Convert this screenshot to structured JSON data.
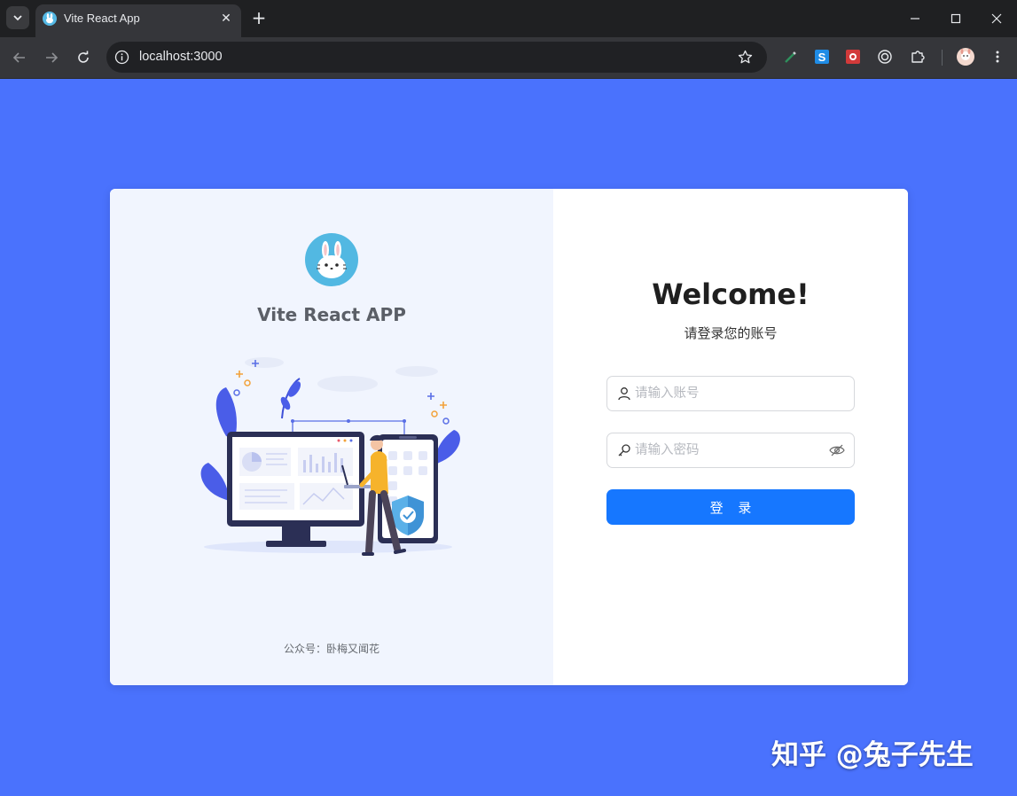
{
  "browser": {
    "tab_title": "Vite React App",
    "url": "localhost:3000",
    "tab_favicon_icon": "bunny-favicon-icon",
    "extensions": [
      "pen-extension-icon",
      "s-extension-icon",
      "red-extension-icon",
      "target-extension-icon",
      "puzzle-extensions-icon"
    ],
    "profile_icon": "profile-avatar-icon"
  },
  "login": {
    "app_title": "Vite React APP",
    "welcome": "Welcome!",
    "subtitle": "请登录您的账号",
    "username_placeholder": "请输入账号",
    "password_placeholder": "请输入密码",
    "login_button": "登 录",
    "footer": "公众号：卧梅又闻花"
  },
  "watermark": "知乎 @兔子先生",
  "colors": {
    "page_background": "#4a72fd",
    "primary_button": "#1677ff",
    "left_panel_bg": "#f1f5fe"
  }
}
